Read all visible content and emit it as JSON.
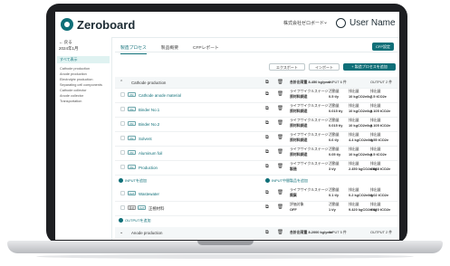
{
  "app": {
    "logo_text": "Zeroboard",
    "tenant": "株式会社ゼロボード",
    "user_name": "User Name",
    "accent_color": "#0f6f78"
  },
  "sidebar": {
    "back_label": "← 戻る",
    "period": "2024年1月",
    "selected": "すべて表示",
    "items": [
      "Cathode production",
      "Anode production",
      "Electrolyte production",
      "Separating cell components",
      "Cathode collector",
      "Anode collector",
      "Transportation"
    ]
  },
  "tabs": [
    "製造プロセス",
    "製品概要",
    "CFPレポート"
  ],
  "settings_button": "CFP設定",
  "actions": {
    "export": "エクスポート",
    "import": "インポート",
    "add_process": "+ 製造プロセスを追加"
  },
  "table": {
    "header": {
      "name": "Cathode production",
      "output_total": "合計出荷量 8.450 kg/year",
      "input_col": "INPUT 6 件",
      "output_col": "OUTPUT 2 件"
    },
    "rows": [
      {
        "tag": "PR",
        "name": "Cathode anode material",
        "stage": "ライフサイクルステージ",
        "stage_value": "原材料調達",
        "a_label": "活動量",
        "a_value": "0.5 t/y",
        "b_label": "排出量",
        "b_value": "10 kgCO2e/kg",
        "c_label": "排出量",
        "c_value": "7.5 tCO2e"
      },
      {
        "tag": "PR",
        "name": "Binder No.1",
        "stage": "ライフサイクルステージ",
        "stage_value": "原材料調達",
        "a_label": "活動量",
        "a_value": "0.015 t/y",
        "b_label": "排出量",
        "b_value": "10 kgCO2e/kg",
        "c_label": "排出量",
        "c_value": "0.105 tCO2e"
      },
      {
        "tag": "PR",
        "name": "Binder No.2",
        "stage": "ライフサイクルステージ",
        "stage_value": "原材料調達",
        "a_label": "活動量",
        "a_value": "0.015 t/y",
        "b_label": "排出量",
        "b_value": "10 kgCO2e/kg",
        "c_label": "排出量",
        "c_value": "0.105 tCO2e"
      },
      {
        "tag": "PR",
        "name": "Solvent",
        "stage": "ライフサイクルステージ",
        "stage_value": "原材料調達",
        "a_label": "活動量",
        "a_value": "0.6 t/y",
        "b_label": "排出量",
        "b_value": "4.4 kgCO2e/kg",
        "c_label": "排出量",
        "c_value": "0.55 tCO2e"
      },
      {
        "tag": "PR",
        "name": "Aluminum foil",
        "stage": "ライフサイクルステージ",
        "stage_value": "原材料調達",
        "a_label": "活動量",
        "a_value": "0.05 t/y",
        "b_label": "排出量",
        "b_value": "10 kgCO2e/kg",
        "c_label": "排出量",
        "c_value": "0.5 tCO2e"
      },
      {
        "tag": "PR",
        "name": "Production",
        "stage": "ライフサイクルステージ",
        "stage_value": "製造",
        "a_label": "活動量",
        "a_value": "3 t/y",
        "b_label": "排出量",
        "b_value": "2.450 kgCO2e/kg",
        "c_label": "排出量",
        "c_value": "6.888 tCO2e"
      }
    ],
    "section_input_add": "INPUTを追加",
    "section_input_mid_add": "INPUT中間製品を追加",
    "output_rows": [
      {
        "tag": "OUT",
        "name": "Wastewater",
        "stage": "ライフサイクルステージ",
        "stage_value": "廃棄",
        "a_label": "活動量",
        "a_value": "0.1 t/y",
        "b_label": "排出量",
        "b_value": "0.2 kgCO2e/kg",
        "c_label": "排出量",
        "c_value": "0.02 tCO2e"
      },
      {
        "tag": "自社",
        "tag2": "OUT",
        "name": "正極材料",
        "stage": "評価対象",
        "stage_value": "OFF",
        "a_label": "活動量",
        "a_value": "1 t/y",
        "b_label": "排出量",
        "b_value": "9.420 kgCO2e/kg",
        "c_label": "排出量",
        "c_value": "9.420 tCO2e"
      }
    ],
    "section_output_add": "OUTPUTを追加",
    "next_header": {
      "name": "Anode production",
      "output_total": "合計出荷量 8.2000 kg/year",
      "input_col": "INPUT 5 件",
      "output_col": "OUTPUT 2 件"
    }
  }
}
